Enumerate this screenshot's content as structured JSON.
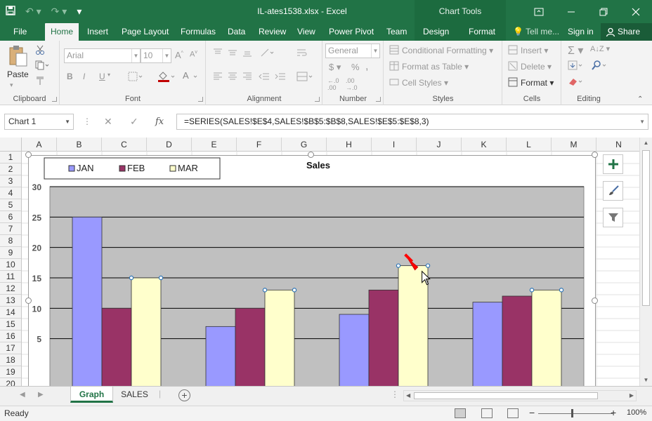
{
  "app": {
    "title": "IL-ates1538.xlsx - Excel",
    "context_tools_title": "Chart Tools"
  },
  "ribbon_tabs": [
    "File",
    "Home",
    "Insert",
    "Page Layout",
    "Formulas",
    "Data",
    "Review",
    "View",
    "Power Pivot",
    "Team",
    "Design",
    "Format"
  ],
  "active_tab": "Home",
  "tell_me": "Tell me...",
  "sign_in": "Sign in",
  "share": "Share",
  "ribbon": {
    "clipboard": {
      "label": "Clipboard",
      "paste": "Paste"
    },
    "font": {
      "label": "Font",
      "font_name": "Arial",
      "font_size": "10",
      "bold": "B",
      "italic": "I",
      "underline": "U"
    },
    "alignment": {
      "label": "Alignment"
    },
    "number": {
      "label": "Number",
      "format": "General"
    },
    "styles": {
      "label": "Styles",
      "conditional": "Conditional Formatting",
      "format_table": "Format as Table",
      "cell_styles": "Cell Styles"
    },
    "cells": {
      "label": "Cells",
      "insert": "Insert",
      "delete": "Delete",
      "format": "Format"
    },
    "editing": {
      "label": "Editing"
    }
  },
  "formula_bar": {
    "name_box": "Chart 1",
    "fx": "fx",
    "formula": "=SERIES(SALES!$E$4,SALES!$B$5:$B$8,SALES!$E$5:$E$8,3)"
  },
  "columns": [
    "A",
    "B",
    "C",
    "D",
    "E",
    "F",
    "G",
    "H",
    "I",
    "J",
    "K",
    "L",
    "M",
    "N"
  ],
  "rows": [
    "1",
    "2",
    "3",
    "4",
    "5",
    "6",
    "7",
    "8",
    "9",
    "10",
    "11",
    "12",
    "13",
    "14",
    "15",
    "16",
    "17",
    "18",
    "19",
    "20"
  ],
  "chart_data": {
    "type": "bar",
    "title": "Sales",
    "categories": [
      "",
      "",
      "",
      ""
    ],
    "series": [
      {
        "name": "JAN",
        "color": "#9999ff",
        "values": [
          25,
          7,
          9,
          11
        ]
      },
      {
        "name": "FEB",
        "color": "#993366",
        "values": [
          10,
          10,
          13,
          12
        ]
      },
      {
        "name": "MAR",
        "color": "#ffffcc",
        "values": [
          15,
          13,
          17,
          13
        ]
      }
    ],
    "ylim": [
      0,
      30
    ],
    "yticks": [
      "30",
      "25",
      "20",
      "15",
      "10",
      "5"
    ],
    "plot_background": "#c0c0c0",
    "grid": true,
    "legend_position": "top-left",
    "selected_series": "MAR"
  },
  "sheets": [
    {
      "name": "Graph",
      "active": true
    },
    {
      "name": "SALES",
      "active": false
    }
  ],
  "status": {
    "ready": "Ready",
    "zoom": "100%"
  },
  "colors": {
    "excel_green": "#217346"
  }
}
